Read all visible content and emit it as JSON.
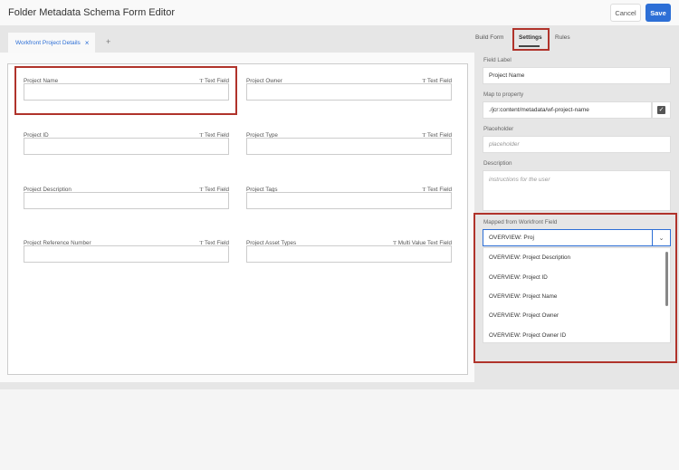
{
  "header": {
    "title": "Folder Metadata Schema Form Editor",
    "cancel_label": "Cancel",
    "save_label": "Save"
  },
  "tabs": [
    {
      "label": "Workfront Project Details",
      "close": "×"
    }
  ],
  "add_tab": "+",
  "fields": [
    {
      "label": "Project Name",
      "type": "Text Field"
    },
    {
      "label": "Project Owner",
      "type": "Text Field"
    },
    {
      "label": "Project ID",
      "type": "Text Field"
    },
    {
      "label": "Project Type",
      "type": "Text Field"
    },
    {
      "label": "Project Description",
      "type": "Text Field"
    },
    {
      "label": "Project Tags",
      "type": "Text Field"
    },
    {
      "label": "Project Reference Number",
      "type": "Text Field"
    },
    {
      "label": "Project Asset Types",
      "type": "Multi Value Text Field"
    }
  ],
  "type_icon": "T",
  "right_tabs": [
    "Build Form",
    "Settings",
    "Rules"
  ],
  "settings": {
    "field_label_label": "Field Label",
    "field_label_value": "Project Name",
    "map_label": "Map to property",
    "map_value": "./jcr:content/metadata/wf-project-name",
    "placeholder_label": "Placeholder",
    "placeholder_ph": "placeholder",
    "description_label": "Description",
    "description_ph": "instructions for the user",
    "mapped_label": "Mapped from Workfront Field",
    "mapped_value": "OVERVIEW: Proj",
    "options": [
      "OVERVIEW: Project Description",
      "OVERVIEW: Project ID",
      "OVERVIEW: Project Name",
      "OVERVIEW: Project Owner",
      "OVERVIEW: Project Owner ID"
    ]
  }
}
